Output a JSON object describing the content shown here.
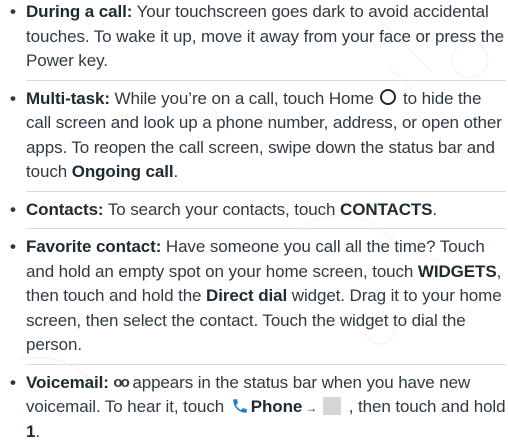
{
  "bullet_char": "•",
  "items": [
    {
      "title": "During a call:",
      "text": " Your touchscreen goes dark to avoid accidental touches. To wake it up, move it away from your face or press the Power key."
    },
    {
      "title": "Multi-task:",
      "text_before_icon": " While you’re on a call, touch Home ",
      "icon": "home-icon",
      "text_after_icon": " to hide the call screen and look up a phone number, address, or open other apps. To reopen the call screen, swipe down the status bar and touch ",
      "bold_end": "Ongoing call",
      "text_end": "."
    },
    {
      "title": "Contacts:",
      "text": " To search your contacts, touch ",
      "bold_end": "CONTACTS",
      "text_end": "."
    },
    {
      "title": "Favorite contact:",
      "text_1": " Have someone you call all the time? Touch and hold an empty spot on your home screen, touch ",
      "bold_1": "WIDGETS",
      "text_2": ", then touch and hold the ",
      "bold_2": "Direct dial",
      "text_3": "  widget. Drag it to your home screen, then select the contact. Touch the widget to dial the person."
    },
    {
      "title": "Voicemail:",
      "icon_voicemail": "voicemail-icon",
      "voicemail_glyph": "oo",
      "text_1": " appears in the status bar when you have new voicemail. To hear it, touch ",
      "icon_phone": "phone-icon",
      "bold_phone": "Phone",
      "arrow": "→",
      "icon_box": "dialpad-icon",
      "text_2": " , then touch and hold ",
      "bold_end": "1",
      "text_end": "."
    }
  ],
  "colors": {
    "text": "#2f3a44",
    "bold": "#1f2a33",
    "phone_icon": "#1f7fc8",
    "separator": "#d8dcdf"
  }
}
